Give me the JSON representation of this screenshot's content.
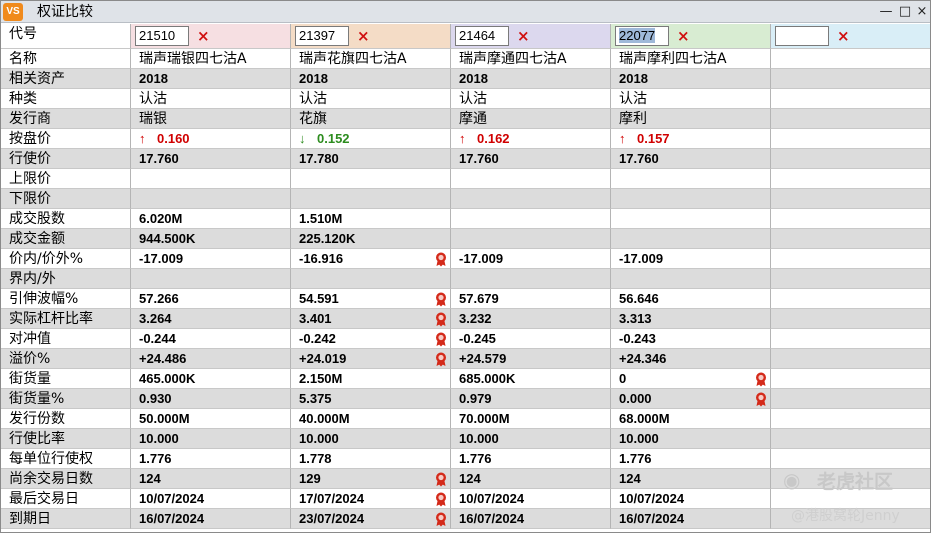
{
  "window": {
    "icon_text": "VS",
    "title": "权证比较",
    "min": "—",
    "max": "□",
    "close": "×"
  },
  "header": {
    "label": "代号",
    "codes": [
      "21510",
      "21397",
      "21464",
      "22077",
      ""
    ],
    "remove": "×"
  },
  "rows": [
    {
      "label": "名称",
      "cn": true,
      "values": [
        "瑞声瑞银四七沽A",
        "瑞声花旗四七沽A",
        "瑞声摩通四七沽A",
        "瑞声摩利四七沽A",
        ""
      ]
    },
    {
      "label": "相关资产",
      "values": [
        "2018",
        "2018",
        "2018",
        "2018",
        ""
      ]
    },
    {
      "label": "种类",
      "cn": true,
      "values": [
        "认沽",
        "认沽",
        "认沽",
        "认沽",
        ""
      ]
    },
    {
      "label": "发行商",
      "cn": true,
      "values": [
        "瑞银",
        "花旗",
        "摩通",
        "摩利",
        ""
      ]
    },
    {
      "label": "按盘价",
      "values": [
        "0.160",
        "0.152",
        "0.162",
        "0.157",
        ""
      ],
      "dirs": [
        "up",
        "down",
        "up",
        "up",
        ""
      ]
    },
    {
      "label": "行使价",
      "values": [
        "17.760",
        "17.780",
        "17.760",
        "17.760",
        ""
      ]
    },
    {
      "label": "上限价",
      "values": [
        "",
        "",
        "",
        "",
        ""
      ]
    },
    {
      "label": "下限价",
      "values": [
        "",
        "",
        "",
        "",
        ""
      ]
    },
    {
      "label": "成交股数",
      "values": [
        "6.020M",
        "1.510M",
        "",
        "",
        ""
      ]
    },
    {
      "label": "成交金额",
      "values": [
        "944.500K",
        "225.120K",
        "",
        "",
        ""
      ]
    },
    {
      "label": "价内/价外%",
      "values": [
        "-17.009",
        "-16.916",
        "-17.009",
        "-17.009",
        ""
      ],
      "badges": [
        false,
        true,
        false,
        false,
        false
      ]
    },
    {
      "label": "界内/外",
      "values": [
        "",
        "",
        "",
        "",
        ""
      ]
    },
    {
      "label": "引伸波幅%",
      "values": [
        "57.266",
        "54.591",
        "57.679",
        "56.646",
        ""
      ],
      "badges": [
        false,
        true,
        false,
        false,
        false
      ]
    },
    {
      "label": "实际杠杆比率",
      "values": [
        "3.264",
        "3.401",
        "3.232",
        "3.313",
        ""
      ],
      "badges": [
        false,
        true,
        false,
        false,
        false
      ]
    },
    {
      "label": "对冲值",
      "values": [
        "-0.244",
        "-0.242",
        "-0.245",
        "-0.243",
        ""
      ],
      "badges": [
        false,
        true,
        false,
        false,
        false
      ]
    },
    {
      "label": "溢价%",
      "values": [
        "+24.486",
        "+24.019",
        "+24.579",
        "+24.346",
        ""
      ],
      "badges": [
        false,
        true,
        false,
        false,
        false
      ]
    },
    {
      "label": "街货量",
      "values": [
        "465.000K",
        "2.150M",
        "685.000K",
        "0",
        ""
      ],
      "badges": [
        false,
        false,
        false,
        true,
        false
      ]
    },
    {
      "label": "街货量%",
      "values": [
        "0.930",
        "5.375",
        "0.979",
        "0.000",
        ""
      ],
      "badges": [
        false,
        false,
        false,
        true,
        false
      ]
    },
    {
      "label": "发行份数",
      "values": [
        "50.000M",
        "40.000M",
        "70.000M",
        "68.000M",
        ""
      ]
    },
    {
      "label": "行使比率",
      "values": [
        "10.000",
        "10.000",
        "10.000",
        "10.000",
        ""
      ]
    },
    {
      "label": "每单位行使权",
      "values": [
        "1.776",
        "1.778",
        "1.776",
        "1.776",
        ""
      ]
    },
    {
      "label": "尚余交易日数",
      "values": [
        "124",
        "129",
        "124",
        "124",
        ""
      ],
      "badges": [
        false,
        true,
        false,
        false,
        false
      ]
    },
    {
      "label": "最后交易日",
      "values": [
        "10/07/2024",
        "17/07/2024",
        "10/07/2024",
        "10/07/2024",
        ""
      ],
      "badges": [
        false,
        true,
        false,
        false,
        false
      ]
    },
    {
      "label": "到期日",
      "values": [
        "16/07/2024",
        "23/07/2024",
        "16/07/2024",
        "16/07/2024",
        ""
      ],
      "badges": [
        false,
        true,
        false,
        false,
        false
      ]
    }
  ],
  "colors": {
    "up": "#d00000",
    "down": "#2c8c1e",
    "badge": "#d42a1a"
  },
  "watermark": {
    "line1": "老虎社区",
    "line2": "@港股窝轮Jenny"
  }
}
